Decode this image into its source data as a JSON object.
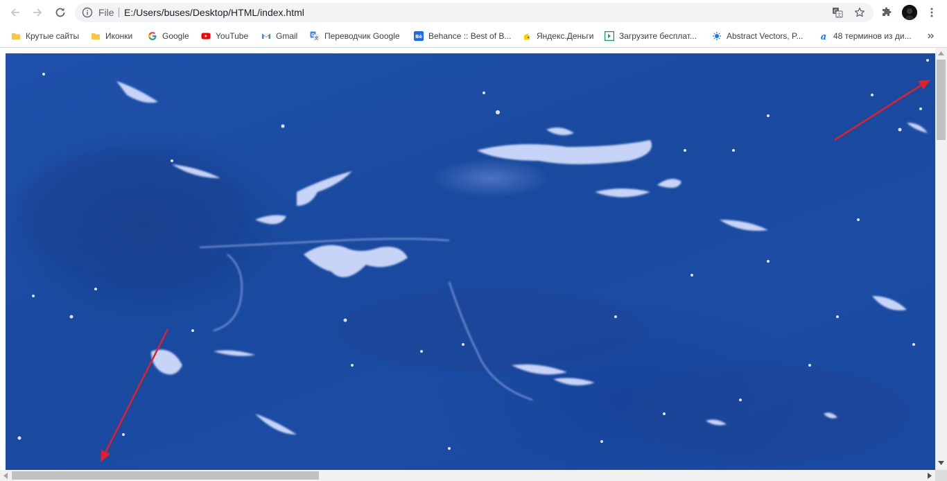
{
  "toolbar": {
    "back_icon": "arrow-left-icon",
    "forward_icon": "arrow-right-icon",
    "reload_icon": "reload-icon",
    "scheme_label": "File",
    "url": "E:/Users/buses/Desktop/HTML/index.html",
    "translate_icon": "translate-icon",
    "bookmark_icon": "star-icon",
    "extensions_icon": "puzzle-icon",
    "menu_icon": "kebab-menu-icon"
  },
  "bookmarks": [
    {
      "label": "Крутые сайты",
      "icon": "folder-icon",
      "color": "#f6c744"
    },
    {
      "label": "Иконки",
      "icon": "folder-icon",
      "color": "#f6c744"
    },
    {
      "label": "Google",
      "icon": "google-icon",
      "color": "#4285f4"
    },
    {
      "label": "YouTube",
      "icon": "youtube-icon",
      "color": "#ff0000"
    },
    {
      "label": "Gmail",
      "icon": "gmail-icon",
      "color": "#ea4335"
    },
    {
      "label": "Переводчик Google",
      "icon": "google-translate-icon",
      "color": "#4285f4"
    },
    {
      "label": "Behance :: Best of B...",
      "icon": "behance-icon",
      "color": "#1769ff"
    },
    {
      "label": "Яндекс.Деньги",
      "icon": "yandex-money-icon",
      "color": "#ffcc00"
    },
    {
      "label": "Загрузите бесплат...",
      "icon": "download-icon",
      "color": "#0f9d58"
    },
    {
      "label": "Abstract Vectors, P...",
      "icon": "abstract-vectors-icon",
      "color": "#1a73e8"
    },
    {
      "label": "48 терминов из ди...",
      "icon": "letter-a-icon",
      "color": "#1a73e8"
    }
  ],
  "bookmarks_overflow_icon": "chevron-double-right-icon",
  "page": {
    "image_description_icon": "satellite-ocean-image",
    "arrow_color": "#e0202a"
  }
}
